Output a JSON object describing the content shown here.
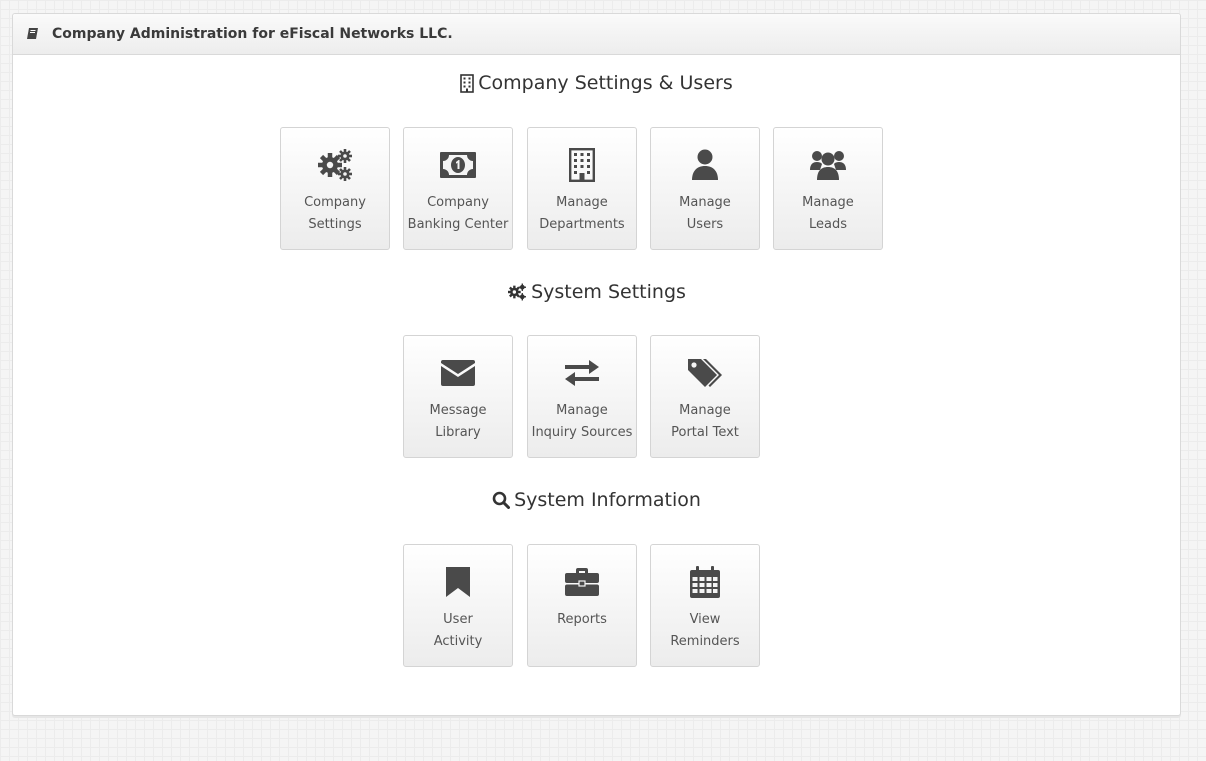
{
  "panel": {
    "title": "Company Administration for eFiscal Networks LLC."
  },
  "sections": [
    {
      "title": "Company Settings & Users",
      "tiles": [
        {
          "line1": "Company",
          "line2": "Settings",
          "icon": "cogs-icon"
        },
        {
          "line1": "Company",
          "line2": "Banking Center",
          "icon": "money-icon"
        },
        {
          "line1": "Manage",
          "line2": "Departments",
          "icon": "building-icon"
        },
        {
          "line1": "Manage",
          "line2": "Users",
          "icon": "user-icon"
        },
        {
          "line1": "Manage",
          "line2": "Leads",
          "icon": "users-icon"
        }
      ]
    },
    {
      "title": "System Settings",
      "tiles": [
        {
          "line1": "Message",
          "line2": "Library",
          "icon": "envelope-icon"
        },
        {
          "line1": "Manage",
          "line2": "Inquiry Sources",
          "icon": "exchange-icon"
        },
        {
          "line1": "Manage",
          "line2": "Portal Text",
          "icon": "tags-icon"
        }
      ]
    },
    {
      "title": "System Information",
      "tiles": [
        {
          "line1": "User",
          "line2": "Activity",
          "icon": "bookmark-icon"
        },
        {
          "line1": "Reports",
          "line2": "",
          "icon": "briefcase-icon"
        },
        {
          "line1": "View",
          "line2": "Reminders",
          "icon": "calendar-icon"
        }
      ]
    }
  ],
  "colors": {
    "icon": "#4a4a4a",
    "tile_border": "#d4d4d4",
    "label": "#555555"
  }
}
